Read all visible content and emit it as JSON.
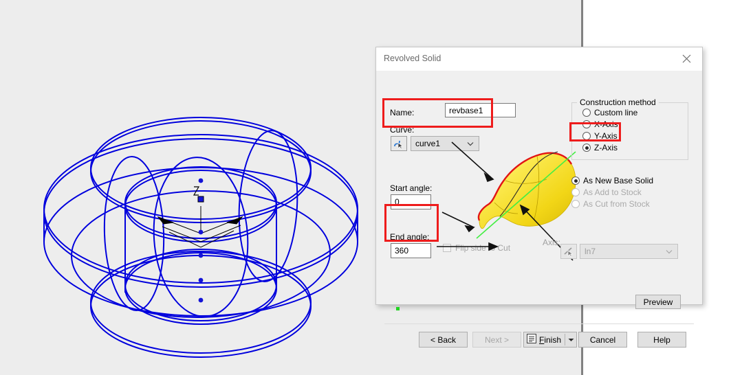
{
  "window": {
    "title": "Revolved Solid",
    "close_icon": "close-icon"
  },
  "form": {
    "name_label": "Name:",
    "name_value": "revbase1",
    "curve_label": "Curve:",
    "curve_value": "curve1",
    "curve_pick_icon": "curve-select-icon",
    "start_angle_label": "Start angle:",
    "start_angle_value": "0",
    "end_angle_label": "End angle:",
    "end_angle_value": "360",
    "flip_side_label": "Flip side to Cut",
    "flip_side_checked": false,
    "axis_label": "Axis:",
    "axis_value": "ln7",
    "axis_pick_icon": "line-select-icon",
    "axis_enabled": false
  },
  "construction_method": {
    "group_title": "Construction method",
    "options": [
      {
        "label": "Custom line",
        "selected": false,
        "enabled": true
      },
      {
        "label": "X-Axis",
        "selected": false,
        "enabled": true
      },
      {
        "label": "Y-Axis",
        "selected": false,
        "enabled": true
      },
      {
        "label": "Z-Axis",
        "selected": true,
        "enabled": true
      }
    ]
  },
  "target_options": [
    {
      "label": "As New Base Solid",
      "selected": true,
      "enabled": true
    },
    {
      "label": "As Add to Stock",
      "selected": false,
      "enabled": false
    },
    {
      "label": "As Cut from Stock",
      "selected": false,
      "enabled": false
    }
  ],
  "buttons": {
    "preview": "Preview",
    "back": "< Back",
    "next": "Next >",
    "finish": "Finish",
    "finish_icon": "list-icon",
    "finish_dropdown_icon": "chevron-down-icon",
    "cancel": "Cancel",
    "help": "Help"
  },
  "viewport": {
    "axis_marker_label": "Z",
    "model": "revolved-solid-wireframe",
    "wire_color": "#0000dd"
  },
  "annotations": [
    {
      "name": "curve-field-highlight"
    },
    {
      "name": "end-angle-field-highlight"
    },
    {
      "name": "z-axis-option-highlight"
    }
  ],
  "colors": {
    "annotation_red": "#ee1c1c",
    "wireframe_blue": "#0000dd",
    "preview_yellow": "#f5e03a",
    "preview_axis_green": "#55ff55"
  }
}
